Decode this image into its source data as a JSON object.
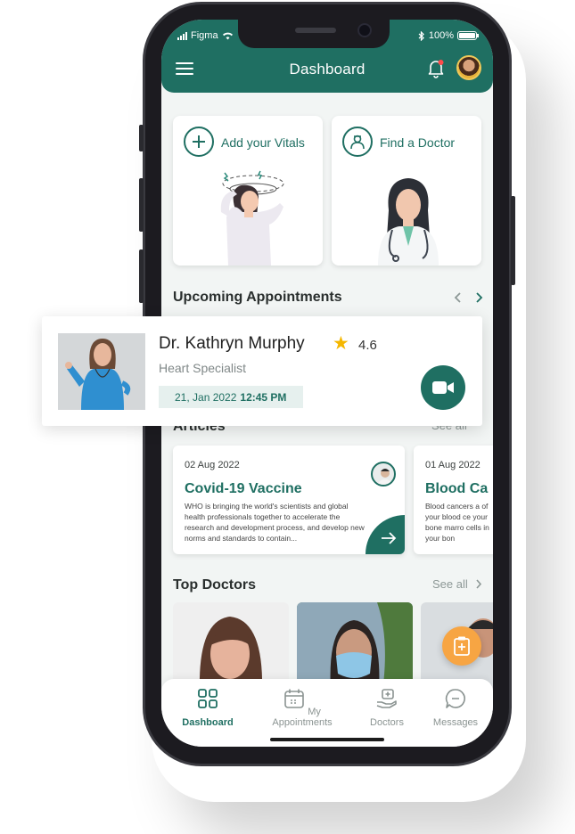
{
  "status_bar": {
    "carrier": "Figma",
    "battery": "100%"
  },
  "header": {
    "title": "Dashboard"
  },
  "quick_actions": [
    {
      "label": "Add your Vitals",
      "icon": "plus-icon"
    },
    {
      "label": "Find a Doctor",
      "icon": "doctor-icon"
    }
  ],
  "appointments": {
    "title": "Upcoming Appointments",
    "card": {
      "doctor_name": "Dr. Kathryn Murphy",
      "specialty": "Heart Specialist",
      "rating": "4.6",
      "date": "21, Jan 2022",
      "time": "12:45 PM"
    }
  },
  "articles": {
    "title": "Articles",
    "see_all": "See all",
    "items": [
      {
        "date": "02 Aug 2022",
        "title": "Covid-19 Vaccine",
        "body": "WHO is bringing the world's scientists and global health professionals together to accelerate the research and development process, and develop new norms and standards to contain..."
      },
      {
        "date": "01 Aug 2022",
        "title": "Blood Ca",
        "body": "Blood cancers a of your blood ce your bone marro cells in your bon"
      }
    ]
  },
  "top_doctors": {
    "title": "Top Doctors",
    "see_all": "See all"
  },
  "nav": [
    {
      "label": "Dashboard",
      "icon": "dashboard-icon",
      "active": true
    },
    {
      "label": "My Appointments",
      "icon": "calendar-icon",
      "active": false
    },
    {
      "label": "Doctors",
      "icon": "doctor-hand-icon",
      "active": false
    },
    {
      "label": "Messages",
      "icon": "message-icon",
      "active": false
    }
  ],
  "colors": {
    "primary": "#1f6f62",
    "accent": "#f7a543",
    "star": "#f5b700"
  }
}
